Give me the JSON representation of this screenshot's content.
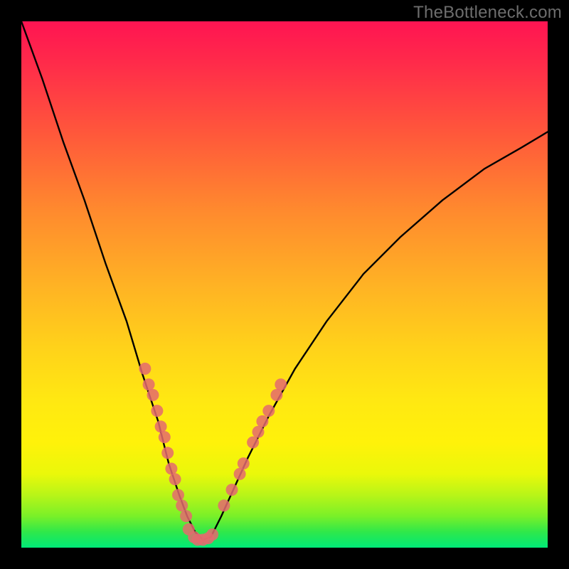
{
  "watermark": "TheBottleneck.com",
  "chart_data": {
    "type": "line",
    "title": "",
    "xlabel": "",
    "ylabel": "",
    "xlim": [
      0,
      100
    ],
    "ylim": [
      0,
      100
    ],
    "background_gradient": [
      "#ff1452",
      "#ffb224",
      "#fff20a",
      "#00e978"
    ],
    "series": [
      {
        "name": "curve",
        "x": [
          0,
          4,
          8,
          12,
          16,
          20,
          23,
          26,
          28,
          30,
          31.5,
          33,
          34.5,
          36,
          38,
          43,
          47,
          52,
          58,
          65,
          72,
          80,
          88,
          95,
          100
        ],
        "y": [
          100,
          89,
          77,
          66,
          54,
          43,
          33,
          24,
          16,
          10,
          6,
          3,
          1.5,
          2,
          6,
          17,
          25,
          34,
          43,
          52,
          59,
          66,
          72,
          76,
          79
        ]
      }
    ],
    "markers": [
      {
        "name": "left-dots",
        "color": "#e46a6f",
        "points": [
          {
            "x": 23.5,
            "y": 34
          },
          {
            "x": 24.2,
            "y": 31
          },
          {
            "x": 25.0,
            "y": 29
          },
          {
            "x": 25.8,
            "y": 26
          },
          {
            "x": 26.5,
            "y": 23
          },
          {
            "x": 27.2,
            "y": 21
          },
          {
            "x": 27.8,
            "y": 18
          },
          {
            "x": 28.5,
            "y": 15
          },
          {
            "x": 29.2,
            "y": 13
          },
          {
            "x": 29.8,
            "y": 10
          },
          {
            "x": 30.5,
            "y": 8
          },
          {
            "x": 31.3,
            "y": 6
          }
        ]
      },
      {
        "name": "bottom-dots",
        "color": "#e46a6f",
        "points": [
          {
            "x": 31.8,
            "y": 3.5
          },
          {
            "x": 32.8,
            "y": 2
          },
          {
            "x": 33.5,
            "y": 1.5
          },
          {
            "x": 34.5,
            "y": 1.5
          },
          {
            "x": 35.5,
            "y": 1.8
          },
          {
            "x": 36.3,
            "y": 2.5
          }
        ]
      },
      {
        "name": "right-dots",
        "color": "#e46a6f",
        "points": [
          {
            "x": 38.5,
            "y": 8
          },
          {
            "x": 40.0,
            "y": 11
          },
          {
            "x": 41.5,
            "y": 14
          },
          {
            "x": 42.2,
            "y": 16
          },
          {
            "x": 44.0,
            "y": 20
          },
          {
            "x": 45.0,
            "y": 22
          },
          {
            "x": 45.8,
            "y": 24
          },
          {
            "x": 47.0,
            "y": 26
          },
          {
            "x": 48.5,
            "y": 29
          },
          {
            "x": 49.3,
            "y": 31
          }
        ]
      }
    ]
  }
}
